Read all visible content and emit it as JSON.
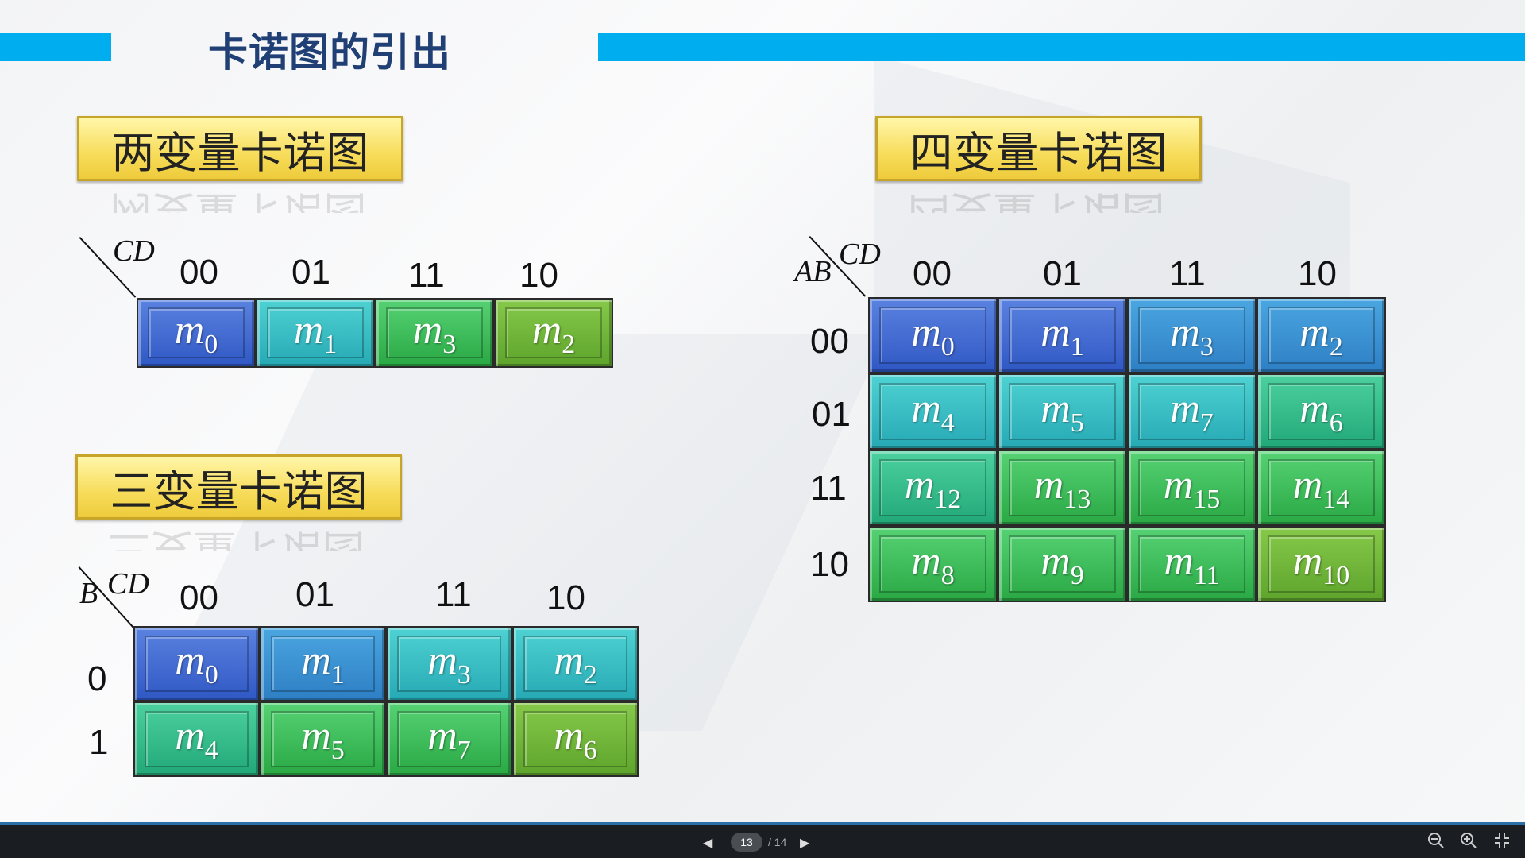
{
  "slide": {
    "title": "卡诺图的引出",
    "two": {
      "label": "两变量卡诺图",
      "col_var": "CD",
      "col_headers": [
        "00",
        "01",
        "11",
        "10"
      ],
      "cells": [
        [
          "m",
          "0"
        ],
        [
          "m",
          "1"
        ],
        [
          "m",
          "3"
        ],
        [
          "m",
          "2"
        ]
      ]
    },
    "three": {
      "label": "三变量卡诺图",
      "row_var": "B",
      "col_var": "CD",
      "col_headers": [
        "00",
        "01",
        "11",
        "10"
      ],
      "row_headers": [
        "0",
        "1"
      ],
      "cells": [
        [
          "m",
          "0"
        ],
        [
          "m",
          "1"
        ],
        [
          "m",
          "3"
        ],
        [
          "m",
          "2"
        ],
        [
          "m",
          "4"
        ],
        [
          "m",
          "5"
        ],
        [
          "m",
          "7"
        ],
        [
          "m",
          "6"
        ]
      ]
    },
    "four": {
      "label": "四变量卡诺图",
      "row_var": "AB",
      "col_var": "CD",
      "col_headers": [
        "00",
        "01",
        "11",
        "10"
      ],
      "row_headers": [
        "00",
        "01",
        "11",
        "10"
      ],
      "cells": [
        [
          "m",
          "0"
        ],
        [
          "m",
          "1"
        ],
        [
          "m",
          "3"
        ],
        [
          "m",
          "2"
        ],
        [
          "m",
          "4"
        ],
        [
          "m",
          "5"
        ],
        [
          "m",
          "7"
        ],
        [
          "m",
          "6"
        ],
        [
          "m",
          "12"
        ],
        [
          "m",
          "13"
        ],
        [
          "m",
          "15"
        ],
        [
          "m",
          "14"
        ],
        [
          "m",
          "8"
        ],
        [
          "m",
          "9"
        ],
        [
          "m",
          "11"
        ],
        [
          "m",
          "10"
        ]
      ]
    }
  },
  "viewer": {
    "current_page": "13",
    "total_pages": "/ 14",
    "prev_icon": "prev-page-icon",
    "next_icon": "next-page-icon",
    "zoom_out_icon": "zoom-out-icon",
    "zoom_in_icon": "zoom-in-icon",
    "fullscreen_icon": "exit-fullscreen-icon"
  },
  "colors": {
    "accent_bar": "#00aeef",
    "title": "#1f3f75",
    "label_box": "#f7dc5a"
  }
}
